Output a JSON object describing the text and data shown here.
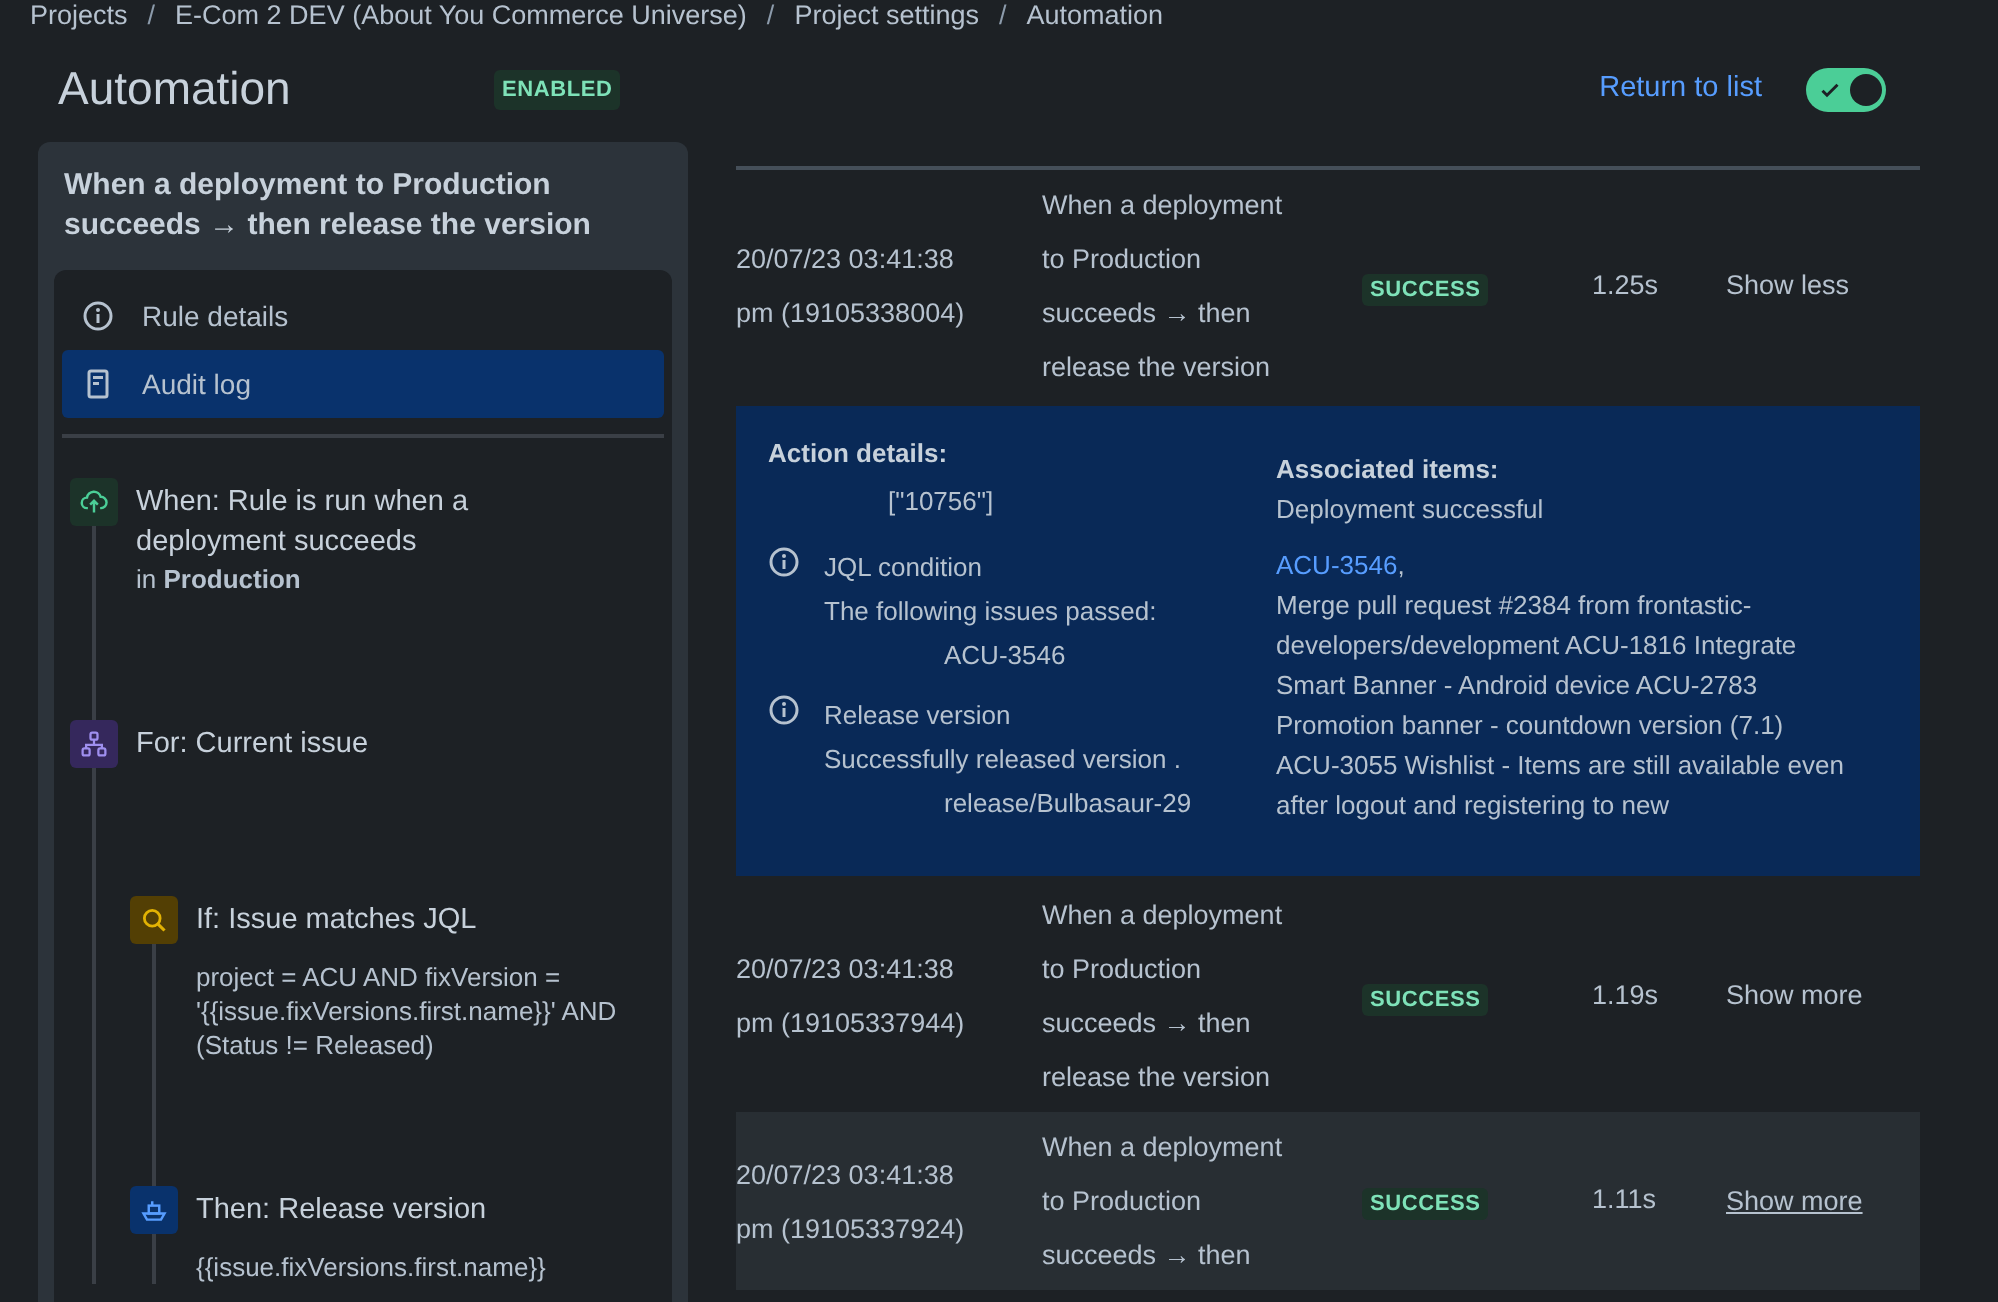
{
  "breadcrumb": [
    "Projects",
    "E-Com 2 DEV (About You Commerce Universe)",
    "Project settings",
    "Automation"
  ],
  "breadcrumb_separator": "/",
  "header": {
    "title": "Automation",
    "badge": "ENABLED",
    "return_link": "Return to list",
    "toggle_on": true
  },
  "sidebar": {
    "title": "When a deployment to Production succeeds → then release the version",
    "nav": [
      {
        "label": "Rule details",
        "kind": "info",
        "selected": false
      },
      {
        "label": "Audit log",
        "kind": "log",
        "selected": true
      }
    ],
    "steps": [
      {
        "kind": "trigger",
        "title": "When: Rule is run when a deployment succeeds",
        "detail": "in **Production**"
      },
      {
        "kind": "branch",
        "title": "For: Current issue",
        "children": [
          {
            "kind": "condition",
            "title": "If: Issue matches JQL",
            "detail": "project = ACU AND fixVersion = '{{issue.fixVersions.first.name}}' AND (Status != Released)"
          },
          {
            "kind": "action",
            "title": "Then: Release version",
            "detail": "{{issue.fixVersions.first.name}}"
          }
        ]
      }
    ]
  },
  "table": {
    "rows": [
      {
        "date": "20/07/23 03:41:38 pm (19105338004)",
        "rule": "When a deployment to Production succeeds → then release the version",
        "status": "SUCCESS",
        "duration": "1.25s",
        "operation": "Show less",
        "hovered": false,
        "details": {
          "action_title": "Action details:",
          "action_value": "[\"10756\"]",
          "entries": [
            {
              "title": "JQL condition",
              "text": "The following issues passed:",
              "value": "ACU-3546"
            },
            {
              "title": "Release version",
              "text": "Successfully released version .",
              "value": "release/Bulbasaur-29"
            }
          ],
          "associated_title": "Associated items:",
          "associated_subtitle": "Deployment successful",
          "link": "ACU-3546",
          "link_suffix": ",",
          "associated_text": "Merge pull request #2384 from frontastic-developers/development ACU-1816 Integrate Smart Banner - Android device  ACU-2783 Promotion banner - countdown version (7.1) ACU-3055 Wishlist - Items are still available even after logout and registering to new"
        }
      },
      {
        "date": "20/07/23 03:41:38 pm (19105337944)",
        "rule": "When a deployment to Production succeeds → then release the version",
        "status": "SUCCESS",
        "duration": "1.19s",
        "operation": "Show more",
        "hovered": false
      },
      {
        "date": "20/07/23 03:41:38 pm (19105337924)",
        "rule": "When a deployment to Production succeeds → then",
        "status": "SUCCESS",
        "duration": "1.11s",
        "operation": "Show more",
        "hovered": true
      }
    ]
  }
}
